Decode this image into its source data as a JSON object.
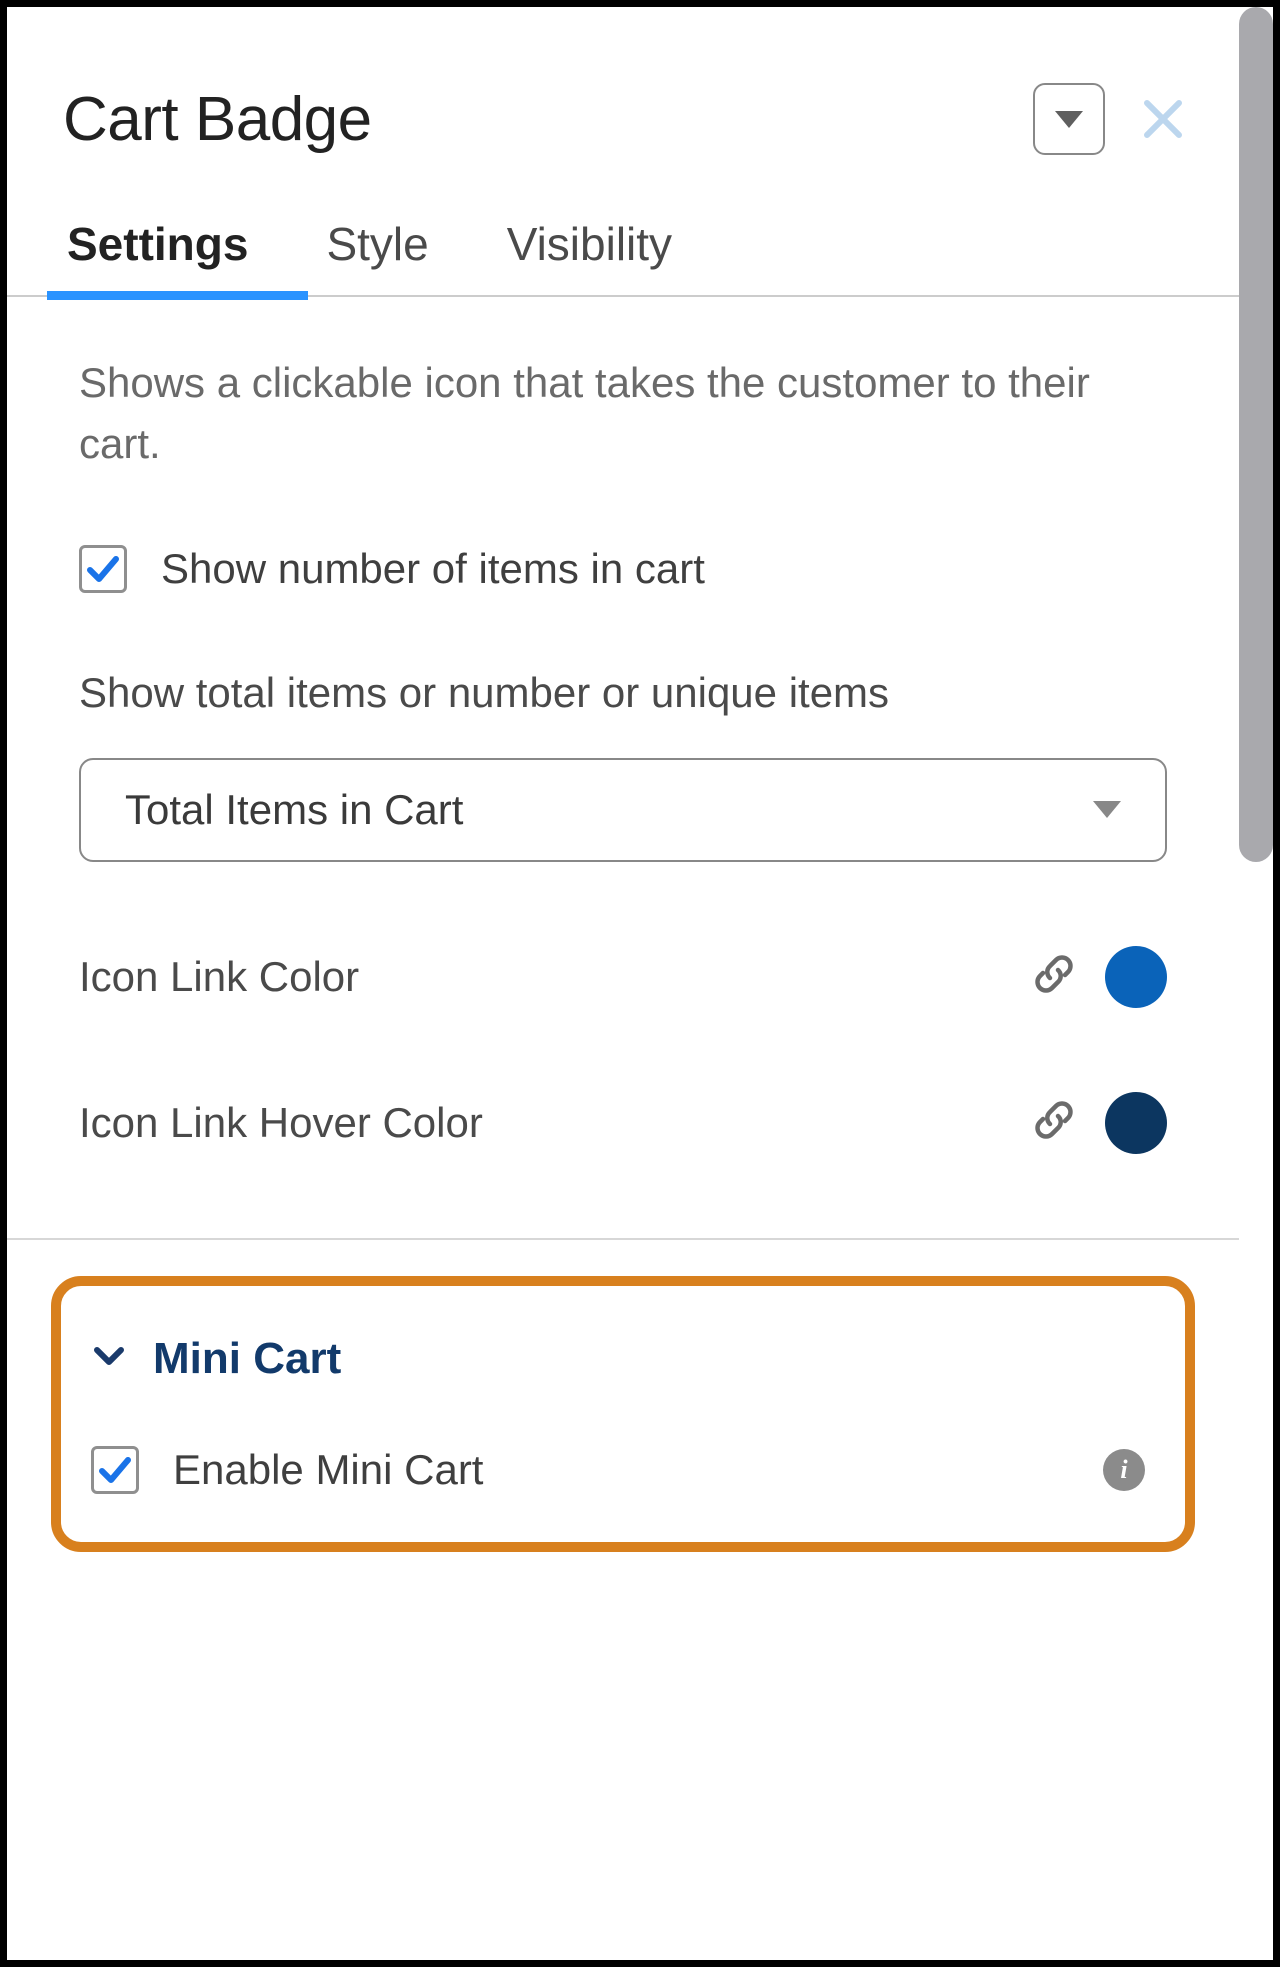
{
  "header": {
    "title": "Cart Badge"
  },
  "tabs": {
    "settings": "Settings",
    "style": "Style",
    "visibility": "Visibility"
  },
  "description": "Shows a clickable icon that takes the customer to their cart.",
  "show_items_checkbox": {
    "label": "Show number of items in cart",
    "checked": true
  },
  "count_type": {
    "label": "Show total items or number or unique items",
    "value": "Total Items in Cart"
  },
  "colors": {
    "icon_link": {
      "label": "Icon Link Color",
      "hex": "#0a63b9"
    },
    "icon_link_hover": {
      "label": "Icon Link Hover Color",
      "hex": "#0c3660"
    }
  },
  "mini_cart": {
    "section_title": "Mini Cart",
    "enable_label": "Enable Mini Cart",
    "enabled": true
  }
}
